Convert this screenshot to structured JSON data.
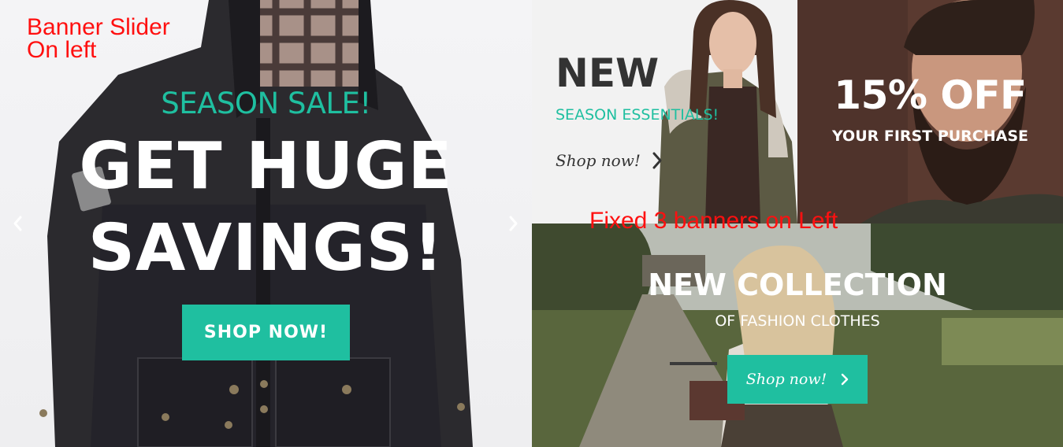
{
  "annotations": {
    "slider_note_line1": "Banner Slider",
    "slider_note_line2": "On left",
    "banners_note": "Fixed 3 banners on Left"
  },
  "slider": {
    "eyebrow": "SEASON SALE!",
    "title_line1": "GET HUGE",
    "title_line2": "SAVINGS!",
    "button_label": "SHOP NOW!",
    "prev_icon": "chevron-left-icon",
    "next_icon": "chevron-right-icon"
  },
  "banner_new": {
    "title": "NEW",
    "subtitle": "SEASON ESSENTIALS!",
    "link_label": "Shop now!",
    "link_icon": "chevron-right-icon"
  },
  "banner_discount": {
    "title": "15% OFF",
    "subtitle": "YOUR FIRST PURCHASE"
  },
  "banner_collection": {
    "title": "NEW COLLECTION",
    "subtitle": "OF FASHION CLOTHES",
    "button_label": "Shop now!",
    "button_icon": "chevron-right-icon"
  },
  "colors": {
    "accent": "#1fbfa0",
    "annotation": "#ff1010",
    "dark_text": "#333333"
  }
}
